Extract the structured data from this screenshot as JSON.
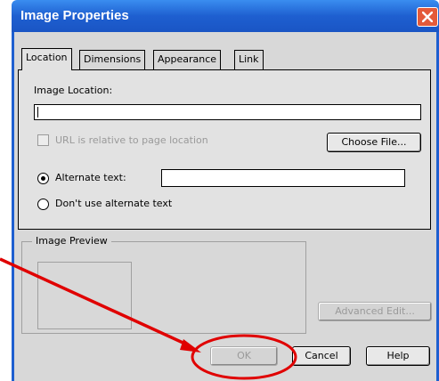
{
  "dialog": {
    "title": "Image Properties"
  },
  "tabs": [
    {
      "label": "Location",
      "active": true
    },
    {
      "label": "Dimensions",
      "active": false
    },
    {
      "label": "Appearance",
      "active": false
    },
    {
      "label": "Link",
      "active": false
    }
  ],
  "location": {
    "image_location_label": "Image Location:",
    "image_location_value": "",
    "url_relative_label": "URL is relative to page location",
    "url_relative_checked": false,
    "url_relative_enabled": false,
    "choose_file_label": "Choose File...",
    "alt_text_label": "Alternate text:",
    "alt_text_value": "",
    "alt_text_selected": true,
    "no_alt_text_label": "Don't use alternate text"
  },
  "preview": {
    "legend": "Image Preview"
  },
  "buttons": {
    "advanced_edit": "Advanced Edit...",
    "ok": "OK",
    "cancel": "Cancel",
    "help": "Help"
  },
  "colors": {
    "title_bar": "#1e5fd0",
    "annotation": "#e00000"
  }
}
